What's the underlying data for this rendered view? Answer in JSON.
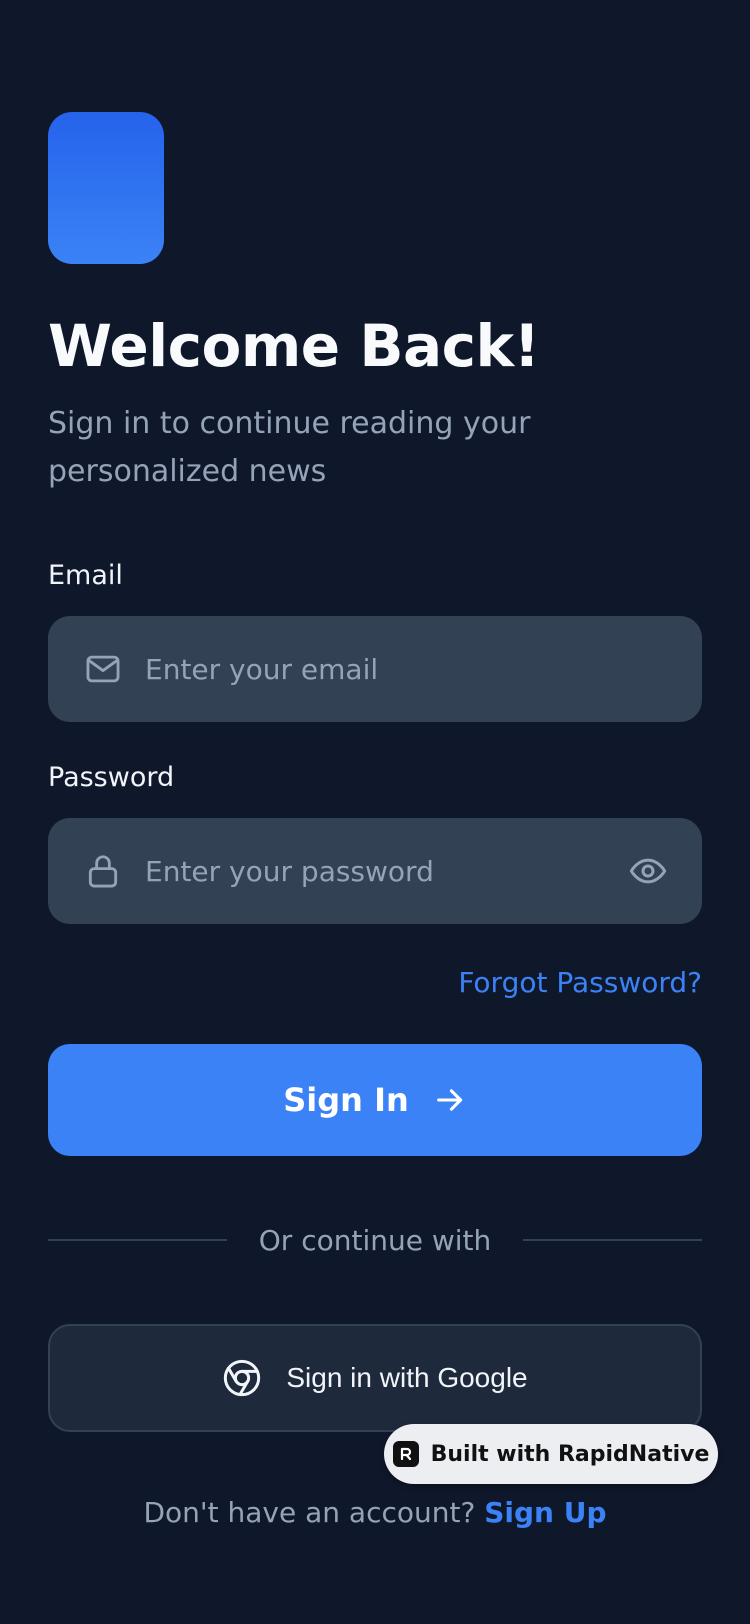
{
  "header": {
    "title": "Welcome Back!",
    "subtitle": "Sign in to continue reading your personalized news"
  },
  "form": {
    "email_label": "Email",
    "email_placeholder": "Enter your email",
    "email_value": "",
    "password_label": "Password",
    "password_placeholder": "Enter your password",
    "password_value": "",
    "forgot_label": "Forgot Password?",
    "signin_label": "Sign In"
  },
  "divider": {
    "text": "Or continue with"
  },
  "social": {
    "google_label": "Sign in with Google"
  },
  "badge": {
    "label": "Built with RapidNative"
  },
  "footer": {
    "prompt": "Don't have an account?",
    "signup_label": "Sign Up"
  },
  "colors": {
    "background": "#0f172a",
    "accent": "#3b82f6",
    "input_bg": "#334155",
    "muted_text": "#94a3b8"
  },
  "icons": {
    "email": "mail-icon",
    "password": "lock-icon",
    "toggle_visibility": "eye-icon",
    "signin": "arrow-right-icon",
    "google": "chrome-icon",
    "badge": "rapidnative-logo-icon"
  }
}
